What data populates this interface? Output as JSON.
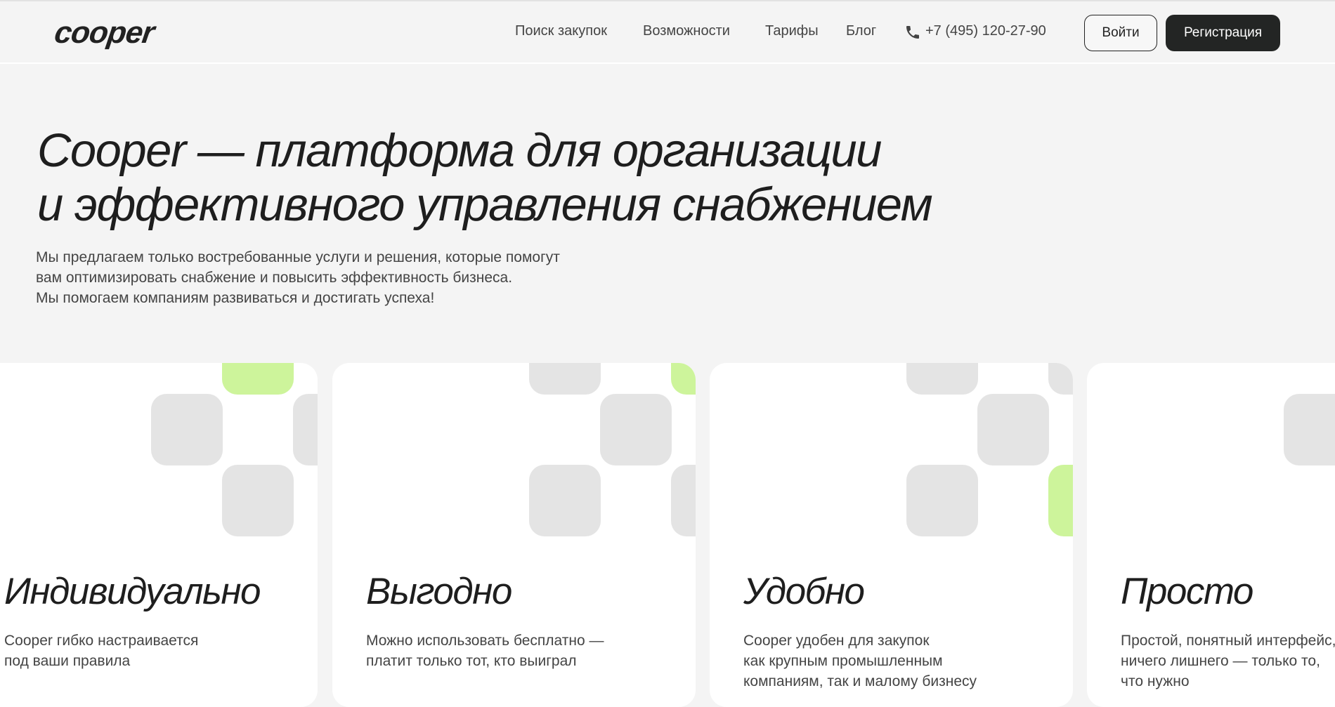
{
  "header": {
    "logo": "cooper",
    "nav": [
      "Поиск закупок",
      "Возможности",
      "Тарифы",
      "Блог"
    ],
    "phone_icon": "phone-icon",
    "phone": "+7 (495) 120-27-90",
    "login_label": "Войти",
    "register_label": "Регистрация"
  },
  "hero": {
    "title_line1": "Cooper — платформа для организации",
    "title_line2": "и эффективного управления снабжением",
    "text_lines": [
      "Мы предлагаем только востребованные услуги и решения, которые помогут",
      "вам оптимизировать снабжение и повысить эффективность бизнеса.",
      "Мы помогаем компаниям развиваться и достигать успеха!"
    ]
  },
  "cards": [
    {
      "title": "Индивидуально",
      "desc": [
        "Cooper гибко настраивается",
        "под ваши правила"
      ]
    },
    {
      "title": "Выгодно",
      "desc": [
        "Можно использовать бесплатно —",
        "платит только тот, кто выиграл"
      ]
    },
    {
      "title": "Удобно",
      "desc": [
        "Cooper удобен для закупок",
        "как крупным промышленным",
        "компаниям, так и малому бизнесу"
      ]
    },
    {
      "title": "Просто",
      "desc": [
        "Простой, понятный интерфейс,",
        "ничего лишнего — только то,",
        "что нужно"
      ]
    }
  ],
  "colors": {
    "accent": "#cdf49b",
    "tile": "#e4e4e4",
    "dark": "#232524"
  }
}
